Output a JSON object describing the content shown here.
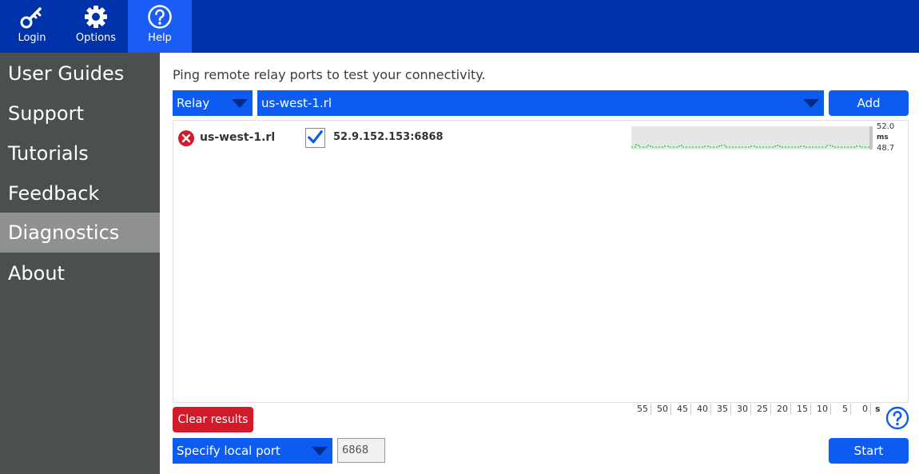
{
  "toolbar": {
    "login_label": "Login",
    "options_label": "Options",
    "help_label": "Help"
  },
  "sidebar": {
    "items": [
      {
        "label": "User Guides"
      },
      {
        "label": "Support"
      },
      {
        "label": "Tutorials"
      },
      {
        "label": "Feedback"
      },
      {
        "label": "Diagnostics",
        "active": true
      },
      {
        "label": "About"
      }
    ]
  },
  "main": {
    "intro": "Ping remote relay ports to test your connectivity.",
    "type_select": "Relay",
    "host_select": "us-west-1.rl",
    "add_label": "Add",
    "results": [
      {
        "status": "error",
        "name": "us-west-1.rl",
        "checked": true,
        "address": "52.9.152.153:6868",
        "latency_max": "52.0",
        "latency_unit": "ms",
        "latency_min": "48.7"
      }
    ],
    "clear_label": "Clear results",
    "axis_ticks": [
      "55",
      "50",
      "45",
      "40",
      "35",
      "30",
      "25",
      "20",
      "15",
      "10",
      "5",
      "0"
    ],
    "axis_unit": "s",
    "port_mode_select": "Specify local port",
    "port_value": "6868",
    "start_label": "Start"
  },
  "colors": {
    "toolbar_bg": "#0033aa",
    "toolbar_active": "#1a5cf5",
    "sidebar_bg": "#4b4f4d",
    "sidebar_active": "#8f918f",
    "accent": "#0d5cf2",
    "danger": "#d11a2a",
    "spark_line": "#22dd44"
  }
}
